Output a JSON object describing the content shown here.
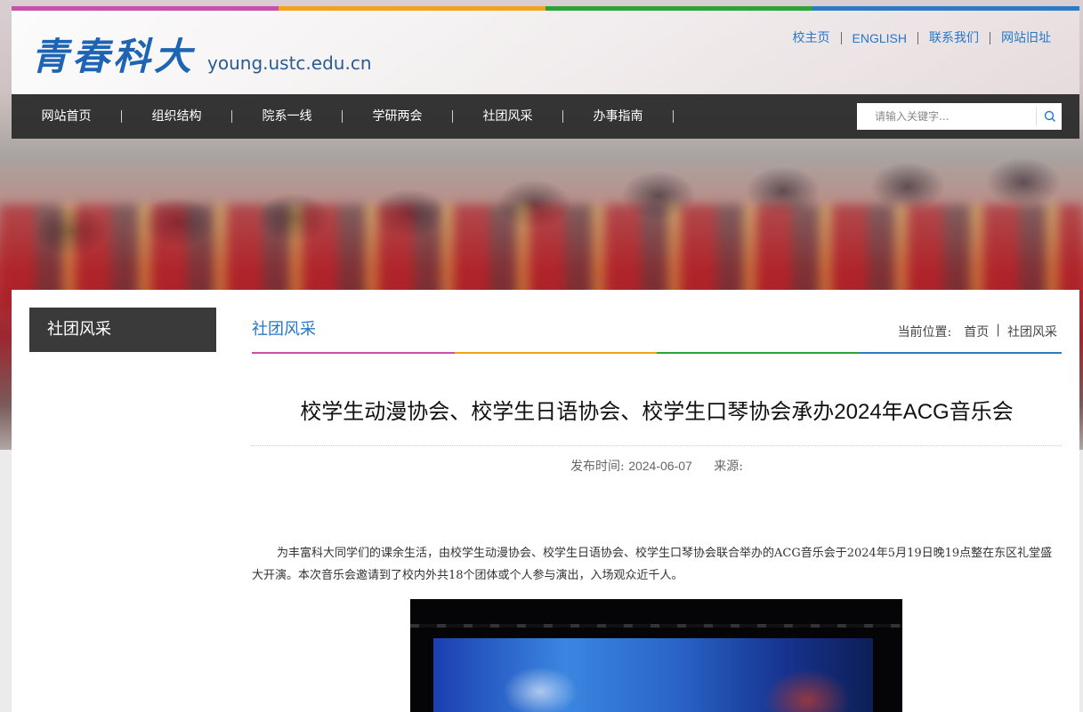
{
  "brand": {
    "logo_text": "青春科大",
    "domain": "young.ustc.edu.cn",
    "stripe_colors": [
      "#c94fa8",
      "#f2a21c",
      "#2aa438",
      "#2a7ac6"
    ]
  },
  "top_links": [
    "校主页",
    "ENGLISH",
    "联系我们",
    "网站旧址"
  ],
  "nav": {
    "items": [
      "网站首页",
      "组织结构",
      "院系一线",
      "学研两会",
      "社团风采",
      "办事指南"
    ],
    "search_placeholder": "请输入关键字..."
  },
  "sidebar": {
    "title": "社团风采"
  },
  "main": {
    "section_title": "社团风采",
    "breadcrumb": {
      "label": "当前位置:",
      "items": [
        "首页",
        "社团风采"
      ]
    },
    "article": {
      "title_pre": "校学生动漫协会、校学生日语协会、校学生口琴协会承办",
      "title_year": "2024",
      "title_mid": "年",
      "title_acg": "ACG",
      "title_post": "音乐会",
      "date_label": "发布时间:",
      "date": "2024-06-07",
      "source_label": "来源:",
      "paragraph": "为丰富科大同学们的课余生活，由校学生动漫协会、校学生日语协会、校学生口琴协会联合举办的ACG音乐会于2024年5月19日晚19点整在东区礼堂盛大开演。本次音乐会邀请到了校内外共18个团体或个人参与演出，入场观众近千人。"
    }
  },
  "colors": {
    "accent_blue": "#2577c9",
    "nav_bg": "#282828",
    "sidebar_bg": "#3a3a3a"
  }
}
